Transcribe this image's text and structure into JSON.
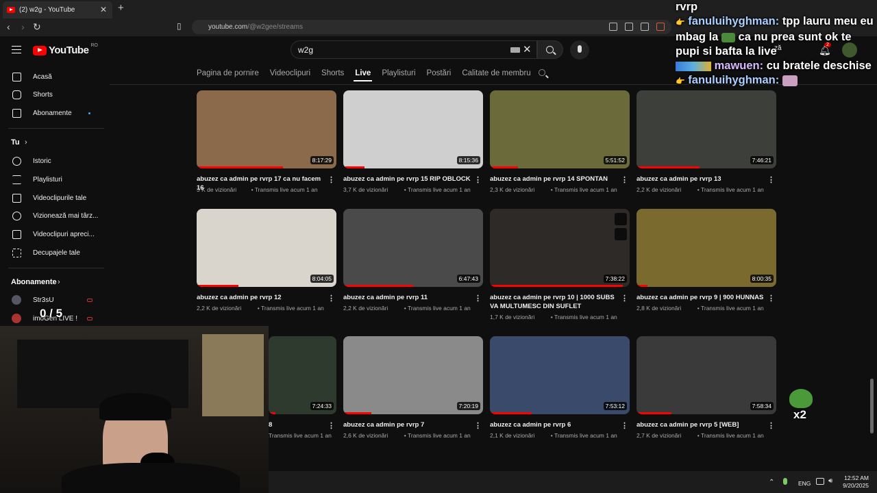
{
  "browser": {
    "tab_title": "(2) w2g - YouTube",
    "url_host": "youtube.com",
    "url_path": "/@w2gee/streams",
    "close_glyph": "✕",
    "new_tab_glyph": "+"
  },
  "header": {
    "logo_text": "YouTube",
    "country_code": "RO",
    "search_value": "w2g",
    "notification_count": "2"
  },
  "channel_tabs": [
    {
      "label": "Pagina de pornire"
    },
    {
      "label": "Videoclipuri"
    },
    {
      "label": "Shorts"
    },
    {
      "label": "Live",
      "active": true
    },
    {
      "label": "Playlisturi"
    },
    {
      "label": "Postări"
    },
    {
      "label": "Calitate de membru"
    }
  ],
  "sidebar": {
    "items": [
      {
        "label": "Acasă",
        "icon": "home-icon"
      },
      {
        "label": "Shorts",
        "icon": "shorts-icon"
      },
      {
        "label": "Abonamente",
        "icon": "subscriptions-icon"
      }
    ],
    "you_heading": "Tu",
    "you_items": [
      {
        "label": "Istoric",
        "icon": "history-icon"
      },
      {
        "label": "Playlisturi",
        "icon": "playlists-icon"
      },
      {
        "label": "Videoclipurile tale",
        "icon": "your-videos-icon"
      },
      {
        "label": "Vizionează mai târz...",
        "icon": "watch-later-icon"
      },
      {
        "label": "Videoclipuri apreci...",
        "icon": "liked-icon"
      },
      {
        "label": "Decupajele tale",
        "icon": "clips-icon"
      }
    ],
    "subs_heading": "Abonamente",
    "subs_items": [
      {
        "label": "Str3sU"
      },
      {
        "label": "imoGen LIVE !"
      }
    ]
  },
  "videos": [
    {
      "title": "abuzez ca admin pe rvrp 17 ca nu facem 16",
      "views": "3 K de vizionări",
      "when": "Transmis live acum 1 an",
      "duration": "8:17:29",
      "progress": 0.62,
      "bg": "#8a6a4a"
    },
    {
      "title": "abuzez ca admin pe rvrp 15 RIP OBLOCK",
      "views": "3,7 K de vizionări",
      "when": "Transmis live acum 1 an",
      "duration": "8:15:36",
      "progress": 0.15,
      "bg": "#cfcfcf"
    },
    {
      "title": "abuzez ca admin pe rvrp 14 SPONTAN",
      "views": "2,3 K de vizionări",
      "when": "Transmis live acum 1 an",
      "duration": "5:51:52",
      "progress": 0.2,
      "bg": "#6b6a3a"
    },
    {
      "title": "abuzez ca admin pe rvrp 13",
      "views": "2,2 K de vizionări",
      "when": "Transmis live acum 1 an",
      "duration": "7:46:21",
      "progress": 0.45,
      "bg": "#3d3f3a"
    },
    {
      "title": "abuzez ca admin pe rvrp 12",
      "views": "2,2 K de vizionări",
      "when": "Transmis live acum 1 an",
      "duration": "8:04:05",
      "progress": 0.3,
      "bg": "#d9d4cc"
    },
    {
      "title": "abuzez ca admin pe rvrp 11",
      "views": "2,2 K de vizionări",
      "when": "Transmis live acum 1 an",
      "duration": "6:47:43",
      "progress": 0.5,
      "bg": "#4a4a4a"
    },
    {
      "title": "abuzez ca admin pe rvrp 10 | 1000 SUBS VA MULTUMESC DIN SUFLET",
      "views": "1,7 K de vizionări",
      "when": "Transmis live acum 1 an",
      "duration": "7:38:22",
      "progress": 0.95,
      "bg": "#2e2a28"
    },
    {
      "title": "abuzez ca admin pe rvrp 9 | 900 HUNNAS",
      "views": "2,8 K de vizionări",
      "when": "Transmis live acum 1 an",
      "duration": "8:00:35",
      "progress": 0.08,
      "bg": "#7a6a2e"
    },
    {
      "title": "8",
      "views": "",
      "when": "Transmis live acum 1 an",
      "duration": "7:24:33",
      "progress": 0.1,
      "bg": "#2e3a2e"
    },
    {
      "title": "abuzez ca admin pe rvrp 7",
      "views": "2,6 K de vizionări",
      "when": "Transmis live acum 1 an",
      "duration": "7:20:19",
      "progress": 0.2,
      "bg": "#8a8a8a"
    },
    {
      "title": "abuzez ca admin pe rvrp 6",
      "views": "2,1 K de vizionări",
      "when": "Transmis live acum 1 an",
      "duration": "7:53:12",
      "progress": 0.3,
      "bg": "#3a4a6a"
    },
    {
      "title": "abuzez ca admin pe rvrp 5 [WEB]",
      "views": "2,7 K de vizionări",
      "when": "Transmis live acum 1 an",
      "duration": "7:58:34",
      "progress": 0.25,
      "bg": "#3a3a3a"
    }
  ],
  "chat": {
    "lines": [
      {
        "text": "rvrp"
      },
      {
        "user": "fanuluihyghman:",
        "text": "tpp lauru meu eu mbag la ",
        "text2": " ca nu prea sunt ok te pupi si bafta la live"
      },
      {
        "user": "mawuen:",
        "text": "cu bratele deschise"
      },
      {
        "user": "fanuluihyghman:",
        "text": ""
      }
    ],
    "emote_count": "x2"
  },
  "overlay": {
    "counter": "0 / 5"
  },
  "taskbar": {
    "lang": "ENG",
    "time": "12:52 AM",
    "date": "9/20/2025"
  }
}
